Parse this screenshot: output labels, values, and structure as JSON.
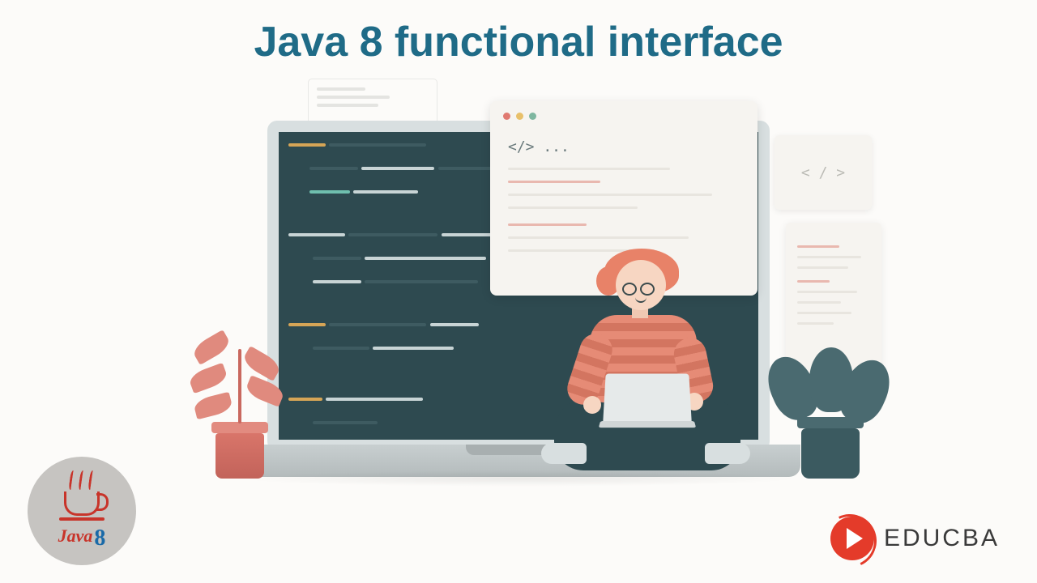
{
  "title": "Java 8 functional interface",
  "speech_label": "</> ...",
  "mini_card_label": "< / >",
  "java_badge": {
    "word": "Java",
    "number": "8"
  },
  "educba": {
    "text": "EDUCBA"
  }
}
